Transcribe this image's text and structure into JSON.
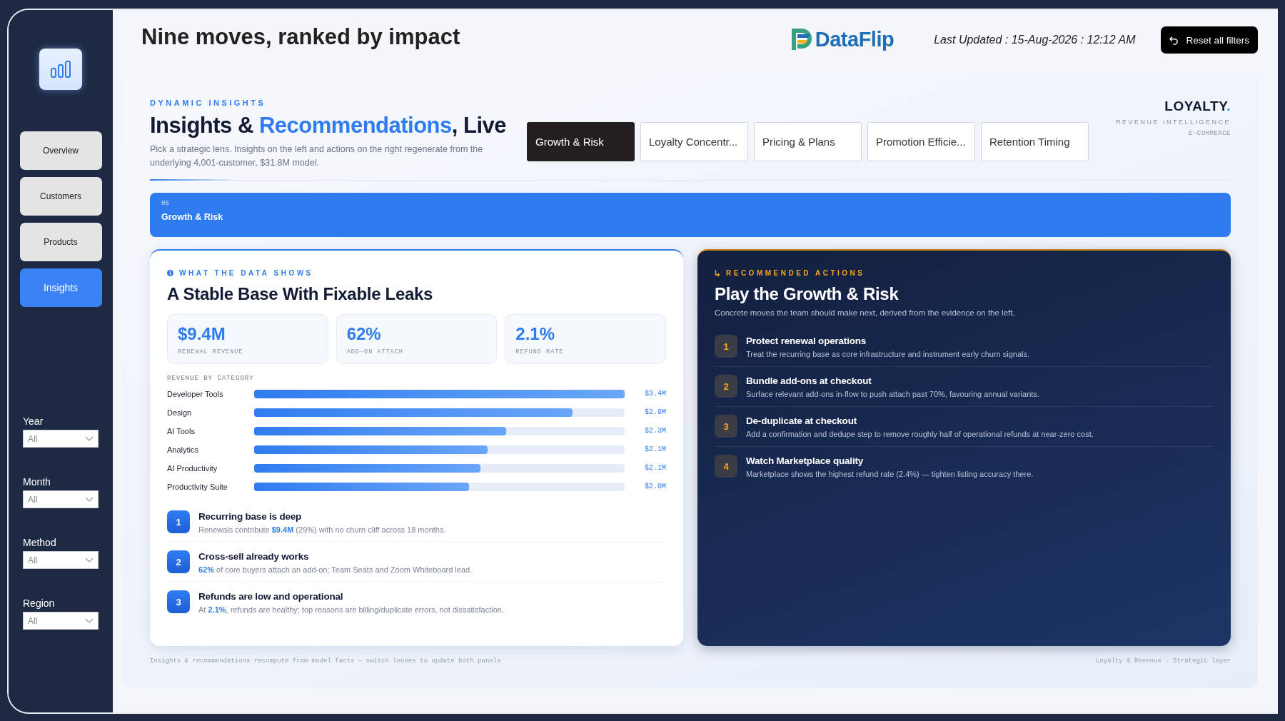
{
  "sidebar": {
    "nav": [
      {
        "label": "Overview",
        "selected": false
      },
      {
        "label": "Customers",
        "selected": false
      },
      {
        "label": "Products",
        "selected": false
      },
      {
        "label": "Insights",
        "selected": true
      }
    ],
    "filters": [
      {
        "label": "Year",
        "value": "All"
      },
      {
        "label": "Month",
        "value": "All"
      },
      {
        "label": "Method",
        "value": "All"
      },
      {
        "label": "Region",
        "value": "All"
      }
    ]
  },
  "header": {
    "title": "Nine moves, ranked by impact",
    "brand": "DataFlip",
    "last_updated": "Last Updated : 15-Aug-2026 : 12:12 AM",
    "reset_button": "Reset all filters"
  },
  "insights": {
    "eyebrow": "DYNAMIC INSIGHTS",
    "title": [
      {
        "text": "Insights & ",
        "accent": false
      },
      {
        "text": "Recommendations",
        "accent": true
      },
      {
        "text": ", Live",
        "accent": false
      }
    ],
    "subtitle": "Pick a strategic lens. Insights on the left and actions on the right regenerate from the underlying 4,001-customer, $31.8M model.",
    "lenses": [
      {
        "label": "Growth & Risk",
        "selected": true
      },
      {
        "label": "Loyalty Concentr...",
        "selected": false
      },
      {
        "label": "Pricing & Plans",
        "selected": false
      },
      {
        "label": "Promotion Efficie...",
        "selected": false
      },
      {
        "label": "Retention Timing",
        "selected": false
      }
    ],
    "badge": {
      "name": [
        {
          "text": "LOYALTY",
          "accent": false
        },
        {
          "text": ".",
          "accent": true
        }
      ],
      "line1": "REVENUE INTELLIGENCE",
      "line2": "E-COMMERCE"
    },
    "banner": {
      "index": "05",
      "title": "Growth & Risk"
    },
    "evidence": {
      "eyebrow": "WHAT THE DATA SHOWS",
      "title": "A Stable Base With Fixable Leaks",
      "stats": [
        {
          "value": "$9.4M",
          "label": "RENEWAL REVENUE"
        },
        {
          "value": "62%",
          "label": "ADD-ON ATTACH"
        },
        {
          "value": "2.1%",
          "label": "REFUND RATE"
        }
      ],
      "chart_title": "REVENUE BY CATEGORY",
      "categories": [
        {
          "label": "Developer Tools",
          "value": "$3.4M",
          "level": 1.0
        },
        {
          "label": "Design",
          "value": "$2.9M",
          "level": 0.86
        },
        {
          "label": "AI Tools",
          "value": "$2.3M",
          "level": 0.68
        },
        {
          "label": "Analytics",
          "value": "$2.1M",
          "level": 0.63
        },
        {
          "label": "AI Productivity",
          "value": "$2.1M",
          "level": 0.61
        },
        {
          "label": "Productivity Suite",
          "value": "$2.0M",
          "level": 0.58
        }
      ],
      "findings": [
        {
          "number": "1",
          "title": "Recurring base is deep",
          "text": "Renewals contribute **$9.4M** (29%) with no churn cliff across 18 months."
        },
        {
          "number": "2",
          "title": "Cross-sell already works",
          "text": "**62%** of core buyers attach an add-on; Team Seats and Zoom Whiteboard lead."
        },
        {
          "number": "3",
          "title": "Refunds are low and operational",
          "text": "At **2.1%**, refunds are healthy; top reasons are billing/duplicate errors, not dissatisfaction."
        }
      ]
    },
    "actions": {
      "eyebrow": "RECOMMENDED ACTIONS",
      "title": "Play the Growth & Risk",
      "subtitle": "Concrete moves the team should make next, derived from the evidence on the left.",
      "items": [
        {
          "number": "1",
          "title": "Protect renewal operations",
          "text": "Treat the recurring base as core infrastructure and instrument early churn signals."
        },
        {
          "number": "2",
          "title": "Bundle add-ons at checkout",
          "text": "Surface relevant add-ons in-flow to push attach past 70%, favouring annual variants."
        },
        {
          "number": "3",
          "title": "De-duplicate at checkout",
          "text": "Add a confirmation and dedupe step to remove roughly half of operational refunds at near-zero cost."
        },
        {
          "number": "4",
          "title": "Watch Marketplace quality",
          "text": "Marketplace shows the highest refund rate (2.4%) — tighten listing accuracy there."
        }
      ]
    },
    "footer": {
      "left": "Insights & recommendations recompute from model facts — switch lenses to update both panels",
      "right": "Loyalty & Revenue · Strategic layer"
    }
  }
}
